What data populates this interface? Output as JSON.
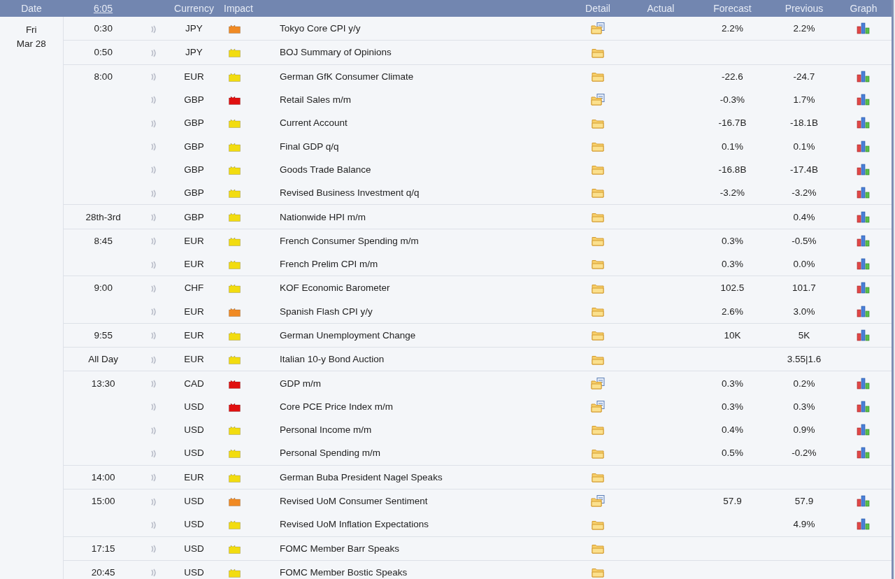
{
  "header": {
    "date": "Date",
    "time": "6:05",
    "currency": "Currency",
    "impact": "Impact",
    "detail": "Detail",
    "actual": "Actual",
    "forecast": "Forecast",
    "previous": "Previous",
    "graph": "Graph"
  },
  "day": {
    "weekday": "Fri",
    "date": "Mar 28"
  },
  "groups": [
    {
      "time": "0:30",
      "events": [
        {
          "currency": "JPY",
          "color": "#f08a24",
          "title": "Tokyo Core CPI y/y",
          "kind": "document",
          "forecast": "2.2%",
          "previous": "2.2%",
          "graph": true
        }
      ]
    },
    {
      "time": "0:50",
      "events": [
        {
          "currency": "JPY",
          "color": "#f2dc10",
          "title": "BOJ Summary of Opinions",
          "kind": "plain",
          "graph": false
        }
      ]
    },
    {
      "time": "8:00",
      "events": [
        {
          "currency": "EUR",
          "color": "#f2dc10",
          "title": "German GfK Consumer Climate",
          "kind": "plain",
          "forecast": "-22.6",
          "previous": "-24.7",
          "graph": true
        },
        {
          "currency": "GBP",
          "color": "#e01010",
          "title": "Retail Sales m/m",
          "kind": "document",
          "forecast": "-0.3%",
          "previous": "1.7%",
          "graph": true
        },
        {
          "currency": "GBP",
          "color": "#f2dc10",
          "title": "Current Account",
          "kind": "plain",
          "forecast": "-16.7B",
          "previous": "-18.1B",
          "graph": true
        },
        {
          "currency": "GBP",
          "color": "#f2dc10",
          "title": "Final GDP q/q",
          "kind": "plain",
          "forecast": "0.1%",
          "previous": "0.1%",
          "graph": true
        },
        {
          "currency": "GBP",
          "color": "#f2dc10",
          "title": "Goods Trade Balance",
          "kind": "plain",
          "forecast": "-16.8B",
          "previous": "-17.4B",
          "graph": true
        },
        {
          "currency": "GBP",
          "color": "#f2dc10",
          "title": "Revised Business Investment q/q",
          "kind": "plain",
          "forecast": "-3.2%",
          "previous": "-3.2%",
          "graph": true
        }
      ]
    },
    {
      "time": "28th-3rd",
      "events": [
        {
          "currency": "GBP",
          "color": "#f2dc10",
          "title": "Nationwide HPI m/m",
          "kind": "plain",
          "previous": "0.4%",
          "graph": true
        }
      ]
    },
    {
      "time": "8:45",
      "events": [
        {
          "currency": "EUR",
          "color": "#f2dc10",
          "title": "French Consumer Spending m/m",
          "kind": "plain",
          "forecast": "0.3%",
          "previous": "-0.5%",
          "graph": true
        },
        {
          "currency": "EUR",
          "color": "#f2dc10",
          "title": "French Prelim CPI m/m",
          "kind": "plain",
          "forecast": "0.3%",
          "previous": "0.0%",
          "graph": true
        }
      ]
    },
    {
      "time": "9:00",
      "events": [
        {
          "currency": "CHF",
          "color": "#f2dc10",
          "title": "KOF Economic Barometer",
          "kind": "plain",
          "forecast": "102.5",
          "previous": "101.7",
          "graph": true
        },
        {
          "currency": "EUR",
          "color": "#f08a24",
          "title": "Spanish Flash CPI y/y",
          "kind": "plain",
          "forecast": "2.6%",
          "previous": "3.0%",
          "graph": true
        }
      ]
    },
    {
      "time": "9:55",
      "events": [
        {
          "currency": "EUR",
          "color": "#f2dc10",
          "title": "German Unemployment Change",
          "kind": "plain",
          "forecast": "10K",
          "previous": "5K",
          "graph": true
        }
      ]
    },
    {
      "time": "All Day",
      "events": [
        {
          "currency": "EUR",
          "color": "#f2dc10",
          "title": "Italian 10-y Bond Auction",
          "kind": "plain",
          "previous": "3.55|1.6",
          "graph": false
        }
      ]
    },
    {
      "time": "13:30",
      "events": [
        {
          "currency": "CAD",
          "color": "#e01010",
          "title": "GDP m/m",
          "kind": "document",
          "forecast": "0.3%",
          "previous": "0.2%",
          "graph": true
        },
        {
          "currency": "USD",
          "color": "#e01010",
          "title": "Core PCE Price Index m/m",
          "kind": "document",
          "forecast": "0.3%",
          "previous": "0.3%",
          "graph": true
        },
        {
          "currency": "USD",
          "color": "#f2dc10",
          "title": "Personal Income m/m",
          "kind": "plain",
          "forecast": "0.4%",
          "previous": "0.9%",
          "graph": true
        },
        {
          "currency": "USD",
          "color": "#f2dc10",
          "title": "Personal Spending m/m",
          "kind": "plain",
          "forecast": "0.5%",
          "previous": "-0.2%",
          "graph": true
        }
      ]
    },
    {
      "time": "14:00",
      "events": [
        {
          "currency": "EUR",
          "color": "#f2dc10",
          "title": "German Buba President Nagel Speaks",
          "kind": "plain",
          "graph": false
        }
      ]
    },
    {
      "time": "15:00",
      "events": [
        {
          "currency": "USD",
          "color": "#f08a24",
          "title": "Revised UoM Consumer Sentiment",
          "kind": "document",
          "forecast": "57.9",
          "previous": "57.9",
          "graph": true
        },
        {
          "currency": "USD",
          "color": "#f2dc10",
          "title": "Revised UoM Inflation Expectations",
          "kind": "plain",
          "previous": "4.9%",
          "graph": true
        }
      ]
    },
    {
      "time": "17:15",
      "events": [
        {
          "currency": "USD",
          "color": "#f2dc10",
          "title": "FOMC Member Barr Speaks",
          "kind": "plain",
          "graph": false
        }
      ]
    },
    {
      "time": "20:45",
      "events": [
        {
          "currency": "USD",
          "color": "#f2dc10",
          "title": "FOMC Member Bostic Speaks",
          "kind": "plain",
          "graph": false
        }
      ]
    }
  ]
}
